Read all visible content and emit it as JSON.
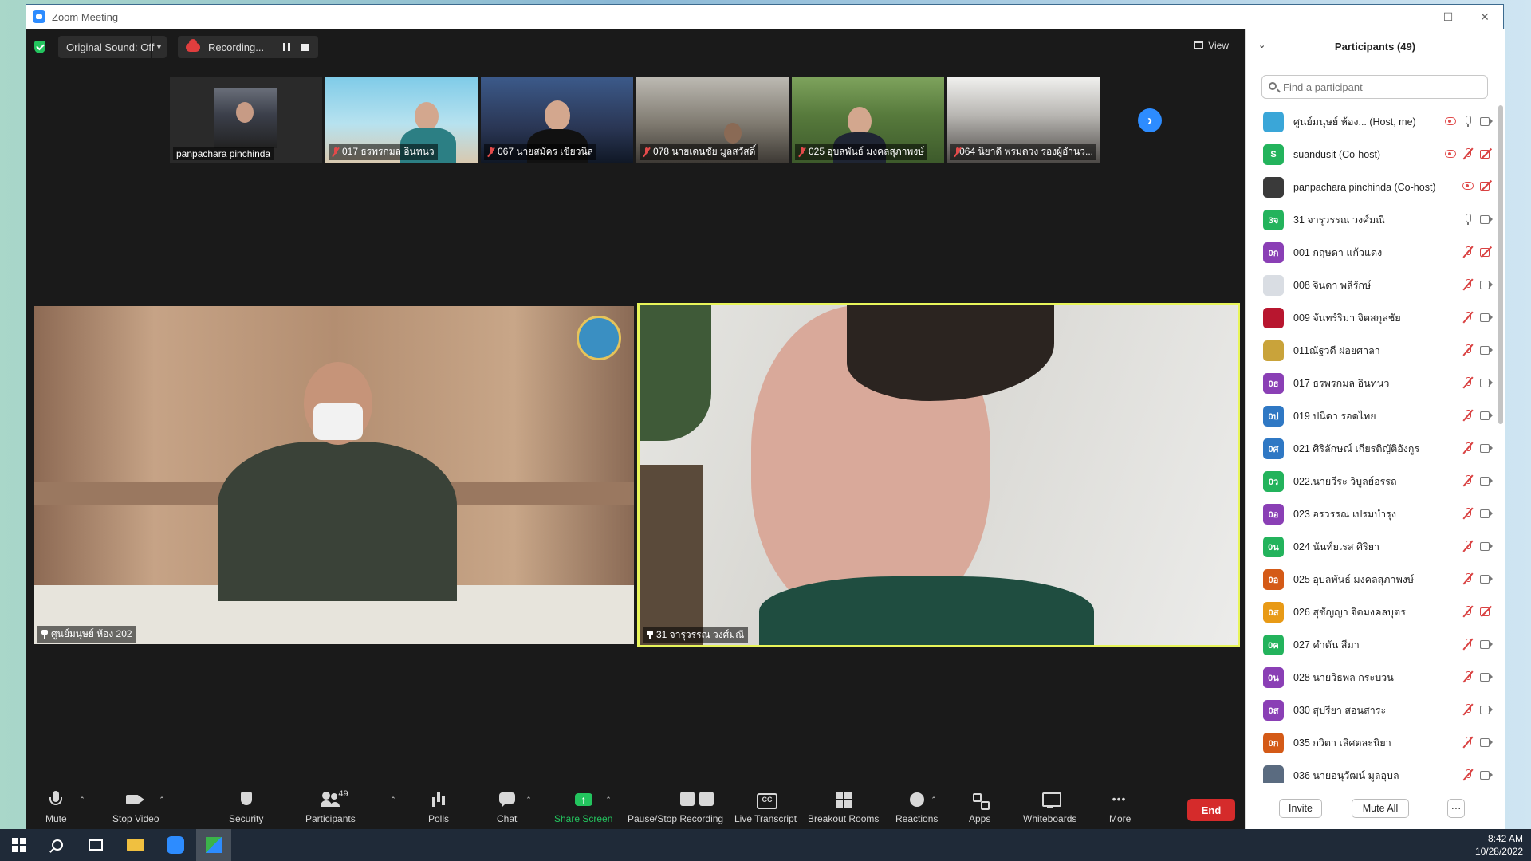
{
  "window": {
    "title": "Zoom Meeting"
  },
  "topbar": {
    "original_sound": "Original Sound: Off",
    "recording": "Recording...",
    "view": "View"
  },
  "thumbnails": [
    {
      "name": "panpachara pinchinda"
    },
    {
      "name": "017 ธรพรกมล อินทนว"
    },
    {
      "name": "067 นายสมัคร เขียวนิล"
    },
    {
      "name": "078 นายเดนชัย มูลสวัสดิ์"
    },
    {
      "name": "025 อุบลพันธ์ มงคลสุภาพงษ์"
    },
    {
      "name": "064 นิยาดี พรมดวง รองผู้อำนว..."
    }
  ],
  "main_videos": {
    "left_label": "ศูนย์มนุษย์ ห้อง 202",
    "right_label": "31 จารุวรรณ วงศ์มณี"
  },
  "toolbar": {
    "mute": "Mute",
    "stop_video": "Stop Video",
    "security": "Security",
    "participants": "Participants",
    "participants_count": "49",
    "polls": "Polls",
    "chat": "Chat",
    "share_screen": "Share Screen",
    "pause_stop_recording": "Pause/Stop Recording",
    "live_transcript": "Live Transcript",
    "breakout_rooms": "Breakout Rooms",
    "reactions": "Reactions",
    "apps": "Apps",
    "whiteboards": "Whiteboards",
    "more": "More",
    "end": "End"
  },
  "panel": {
    "title": "Participants (49)",
    "search_placeholder": "Find a participant",
    "participants": [
      {
        "initials": "",
        "color": "#3aa6d8",
        "name": "ศูนย์มนุษย์ ห้อง... (Host, me)",
        "rec": true,
        "mic": "on",
        "cam": "on"
      },
      {
        "initials": "S",
        "color": "#23b35c",
        "name": "suandusit (Co-host)",
        "rec": true,
        "mic": "off",
        "cam": "off"
      },
      {
        "initials": "",
        "color": "#3a3a3a",
        "name": "panpachara pinchinda (Co-host)",
        "rec": true,
        "mic": "none",
        "cam": "off"
      },
      {
        "initials": "3จ",
        "color": "#23b35c",
        "name": "31 จารุวรรณ วงศ์มณี",
        "rec": false,
        "mic": "on",
        "cam": "on"
      },
      {
        "initials": "0ก",
        "color": "#8a3fb5",
        "name": "001 กฤษดา แก้วแดง",
        "rec": false,
        "mic": "off",
        "cam": "off"
      },
      {
        "initials": "",
        "color": "#d9dde3",
        "name": "008 จินดา พลีรักษ์",
        "rec": false,
        "mic": "off",
        "cam": "on"
      },
      {
        "initials": "",
        "color": "#b8162f",
        "name": "009 จันทร์ริมา จิตสกุลชัย",
        "rec": false,
        "mic": "off",
        "cam": "on"
      },
      {
        "initials": "",
        "color": "#c9a33a",
        "name": "011ณัฐวดี ฝอยศาลา",
        "rec": false,
        "mic": "off",
        "cam": "on"
      },
      {
        "initials": "0ธ",
        "color": "#8a3fb5",
        "name": "017 ธรพรกมล อินทนว",
        "rec": false,
        "mic": "off",
        "cam": "on"
      },
      {
        "initials": "0ป",
        "color": "#2f78c4",
        "name": "019 ปนิดา รอดไทย",
        "rec": false,
        "mic": "off",
        "cam": "on"
      },
      {
        "initials": "0ศ",
        "color": "#2f78c4",
        "name": "021 ศิริลักษณ์ เกียรติญัติอังกูร",
        "rec": false,
        "mic": "off",
        "cam": "on"
      },
      {
        "initials": "0ว",
        "color": "#23b35c",
        "name": "022.นายวีระ วิบูลย์อรรถ",
        "rec": false,
        "mic": "off",
        "cam": "on"
      },
      {
        "initials": "0อ",
        "color": "#8a3fb5",
        "name": "023 อรวรรณ เปรมบำรุง",
        "rec": false,
        "mic": "off",
        "cam": "on"
      },
      {
        "initials": "0น",
        "color": "#23b35c",
        "name": "024 นันท์ยเรส ศิริยา",
        "rec": false,
        "mic": "off",
        "cam": "on"
      },
      {
        "initials": "0อ",
        "color": "#d45a17",
        "name": "025 อุบลพันธ์ มงคลสุภาพงษ์",
        "rec": false,
        "mic": "off",
        "cam": "on"
      },
      {
        "initials": "0ส",
        "color": "#e89a16",
        "name": "026 สุชัญญา จิตมงคลบุตร",
        "rec": false,
        "mic": "off",
        "cam": "off"
      },
      {
        "initials": "0ค",
        "color": "#23b35c",
        "name": "027 คำตัน สีมา",
        "rec": false,
        "mic": "off",
        "cam": "on"
      },
      {
        "initials": "0น",
        "color": "#8a3fb5",
        "name": "028 นายวิธพล กระบวน",
        "rec": false,
        "mic": "off",
        "cam": "on"
      },
      {
        "initials": "0ส",
        "color": "#8a3fb5",
        "name": "030 สุปรียา สอนสาระ",
        "rec": false,
        "mic": "off",
        "cam": "on"
      },
      {
        "initials": "0ก",
        "color": "#d45a17",
        "name": "035 กวิตา เลิศตละนิยา",
        "rec": false,
        "mic": "off",
        "cam": "on"
      },
      {
        "initials": "",
        "color": "#5a6b80",
        "name": "036 นายอนุวัฒน์ มูลอุบล",
        "rec": false,
        "mic": "off",
        "cam": "on"
      }
    ],
    "invite": "Invite",
    "mute_all": "Mute All",
    "more": "···"
  },
  "taskbar": {
    "time": "8:42 AM",
    "date": "10/28/2022"
  }
}
